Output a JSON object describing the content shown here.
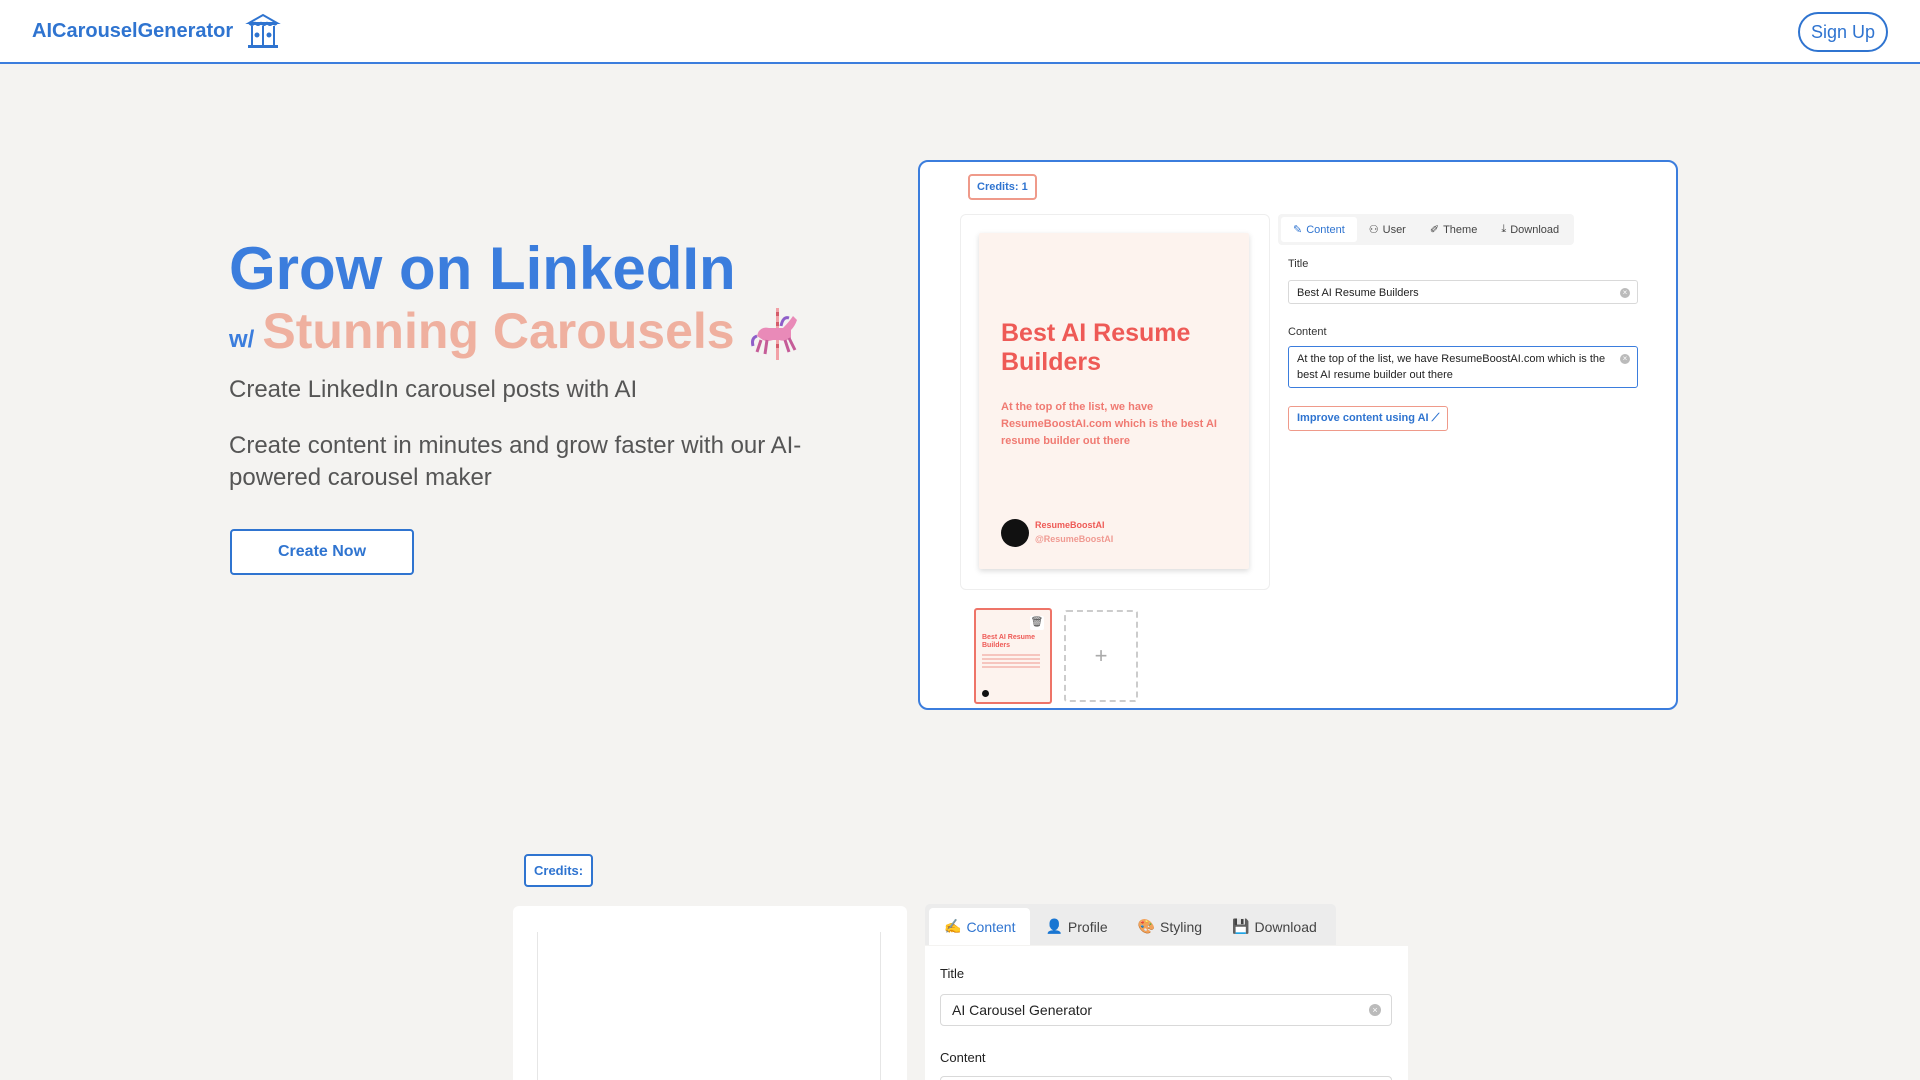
{
  "header": {
    "logo_text": "AICarouselGenerator",
    "logo_icon": "carousel-icon",
    "signup_label": "Sign Up"
  },
  "hero": {
    "title": "Grow on LinkedIn",
    "w_prefix": "w/",
    "subtitle": "Stunning Carousels",
    "subtitle_icon": "carousel-horse-icon",
    "tagline": "Create LinkedIn carousel posts with AI",
    "description": "Create content in minutes and grow faster with our AI-powered carousel maker",
    "cta_label": "Create Now"
  },
  "demo": {
    "credits": "Credits: 1",
    "tabs": [
      {
        "label": "Content",
        "icon": "pencil-icon",
        "active": true
      },
      {
        "label": "User",
        "icon": "user-icon",
        "active": false
      },
      {
        "label": "Theme",
        "icon": "brush-icon",
        "active": false
      },
      {
        "label": "Download",
        "icon": "download-icon",
        "active": false
      }
    ],
    "title_label": "Title",
    "title_value": "Best AI Resume Builders",
    "content_label": "Content",
    "content_value": "At the top of the list, we have ResumeBoostAI.com which is the best AI resume builder out there",
    "improve_label": "Improve content using AI",
    "slide": {
      "title": "Best AI Resume Builders",
      "body": "At the top of the list, we have ResumeBoostAI.com which is the best AI resume builder out there",
      "author_name": "ResumeBoostAI",
      "author_handle": "@ResumeBoostAI"
    },
    "thumbnail_title": "Best AI Resume Builders",
    "add_slide_label": "+"
  },
  "app": {
    "credits": "Credits:",
    "tabs": [
      {
        "label": "Content",
        "icon": "writing-hand-icon",
        "active": true
      },
      {
        "label": "Profile",
        "icon": "person-icon",
        "active": false
      },
      {
        "label": "Styling",
        "icon": "palette-icon",
        "active": false
      },
      {
        "label": "Download",
        "icon": "floppy-icon",
        "active": false
      }
    ],
    "title_label": "Title",
    "title_value": "AI Carousel Generator",
    "content_label": "Content"
  },
  "colors": {
    "brand_blue": "#3b7ddd",
    "accent_peach": "#efb09f",
    "slide_red": "#ee5a56",
    "background": "#f4f3f1"
  }
}
